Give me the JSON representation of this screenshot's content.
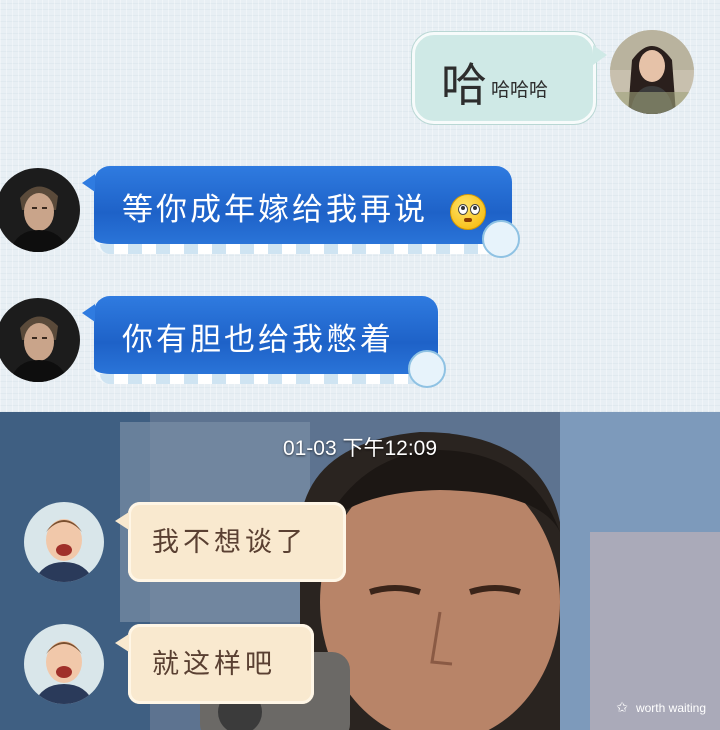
{
  "top_chat": {
    "messages": [
      {
        "side": "right",
        "big_char": "哈",
        "small_text": "哈哈哈"
      },
      {
        "side": "left",
        "text": "等你成年嫁给我再说"
      },
      {
        "side": "left",
        "text": "你有胆也给我憋着"
      }
    ]
  },
  "bottom_chat": {
    "timestamp": "01-03 下午12:09",
    "messages": [
      {
        "side": "left",
        "text": "我不想谈了"
      },
      {
        "side": "left",
        "text": "就这样吧"
      }
    ]
  },
  "watermark": {
    "icon": "star-icon",
    "text": "worth waiting"
  },
  "colors": {
    "top_background": "#e8eff4",
    "mint_bubble": "#cfe9e6",
    "blue_bubble": "#1e62c8",
    "cream_bubble": "#f9e9cf"
  }
}
